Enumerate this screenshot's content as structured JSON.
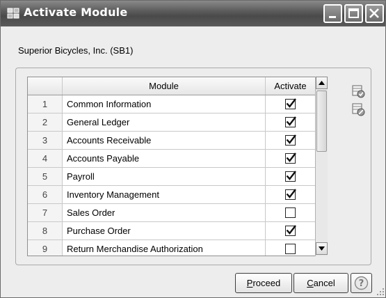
{
  "window": {
    "title": "Activate Module",
    "company": "Superior Bicycles, Inc. (SB1)"
  },
  "grid": {
    "columns": [
      "",
      "Module",
      "Activate"
    ],
    "rows": [
      {
        "num": "1",
        "module": "Common Information",
        "activate": true
      },
      {
        "num": "2",
        "module": "General Ledger",
        "activate": true
      },
      {
        "num": "3",
        "module": "Accounts Receivable",
        "activate": true
      },
      {
        "num": "4",
        "module": "Accounts Payable",
        "activate": true
      },
      {
        "num": "5",
        "module": "Payroll",
        "activate": true
      },
      {
        "num": "6",
        "module": "Inventory Management",
        "activate": true
      },
      {
        "num": "7",
        "module": "Sales Order",
        "activate": false
      },
      {
        "num": "8",
        "module": "Purchase Order",
        "activate": true
      },
      {
        "num": "9",
        "module": "Return Merchandise Authorization",
        "activate": false
      }
    ]
  },
  "buttons": {
    "proceed_underline": "P",
    "proceed_rest": "roceed",
    "cancel_underline": "C",
    "cancel_rest": "ancel"
  },
  "icons": {
    "app": "module-app-icon",
    "select_all": "select-all-icon",
    "clear_all": "clear-all-icon",
    "help": "help-icon"
  }
}
